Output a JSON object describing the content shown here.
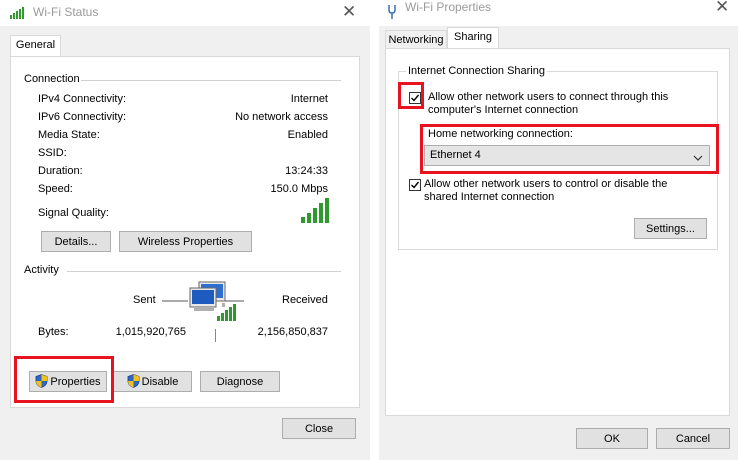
{
  "status_window": {
    "title": "Wi-Fi Status",
    "tab_general": "General",
    "connection_section": "Connection",
    "rows": [
      {
        "label": "IPv4 Connectivity:",
        "value": "Internet"
      },
      {
        "label": "IPv6 Connectivity:",
        "value": "No network access"
      },
      {
        "label": "Media State:",
        "value": "Enabled"
      },
      {
        "label": "SSID:",
        "value": ""
      },
      {
        "label": "Duration:",
        "value": "13:24:33"
      },
      {
        "label": "Speed:",
        "value": "150.0 Mbps"
      }
    ],
    "signal_quality_label": "Signal Quality:",
    "signal_bars": 5,
    "details_button": "Details...",
    "wireless_properties_button": "Wireless Properties",
    "activity_section": "Activity",
    "sent_label": "Sent",
    "received_label": "Received",
    "bytes_label": "Bytes:",
    "bytes_sent": "1,015,920,765",
    "bytes_received": "2,156,850,837",
    "properties_button": "Properties",
    "disable_button": "Disable",
    "diagnose_button": "Diagnose",
    "close_button": "Close"
  },
  "properties_window": {
    "title": "Wi-Fi Properties",
    "tab_networking": "Networking",
    "tab_sharing": "Sharing",
    "ics_group": "Internet Connection Sharing",
    "allow_connect_line1": "Allow other network users to connect through this",
    "allow_connect_line2": "computer's Internet connection",
    "allow_connect_checked": true,
    "home_networking_label": "Home networking connection:",
    "home_networking_value": "Ethernet 4",
    "allow_control_line1": "Allow other network users to control or disable the",
    "allow_control_line2": "shared Internet connection",
    "allow_control_checked": true,
    "settings_button": "Settings...",
    "ok_button": "OK",
    "cancel_button": "Cancel"
  },
  "colors": {
    "highlight_red": "#e8131f",
    "signal_green": "#2e9a2e"
  }
}
